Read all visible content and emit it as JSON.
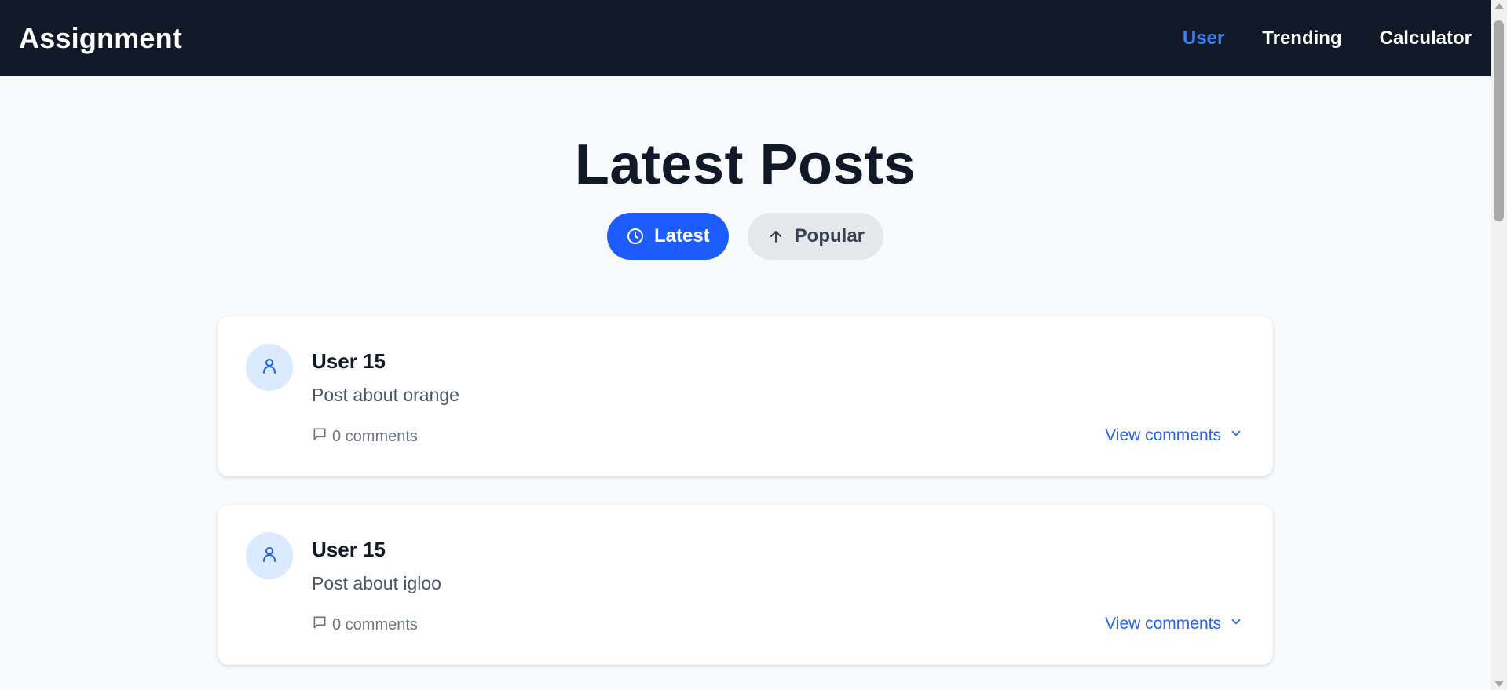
{
  "nav": {
    "brand": "Assignment",
    "links": [
      {
        "label": "User",
        "active": true
      },
      {
        "label": "Trending",
        "active": false
      },
      {
        "label": "Calculator",
        "active": false
      }
    ]
  },
  "main": {
    "title": "Latest Posts",
    "sort": {
      "latest": {
        "label": "Latest",
        "icon": "clock-icon",
        "active": true
      },
      "popular": {
        "label": "Popular",
        "icon": "arrow-up-icon",
        "active": false
      }
    },
    "posts": [
      {
        "author": "User 15",
        "content": "Post about orange",
        "comments": "0 comments",
        "action": "View comments"
      },
      {
        "author": "User 15",
        "content": "Post about igloo",
        "comments": "0 comments",
        "action": "View comments"
      }
    ]
  },
  "colors": {
    "nav_bg": "#111827",
    "accent": "#1d5cff",
    "link_active": "#3b82f6",
    "page_bg": "#f8fafc"
  }
}
